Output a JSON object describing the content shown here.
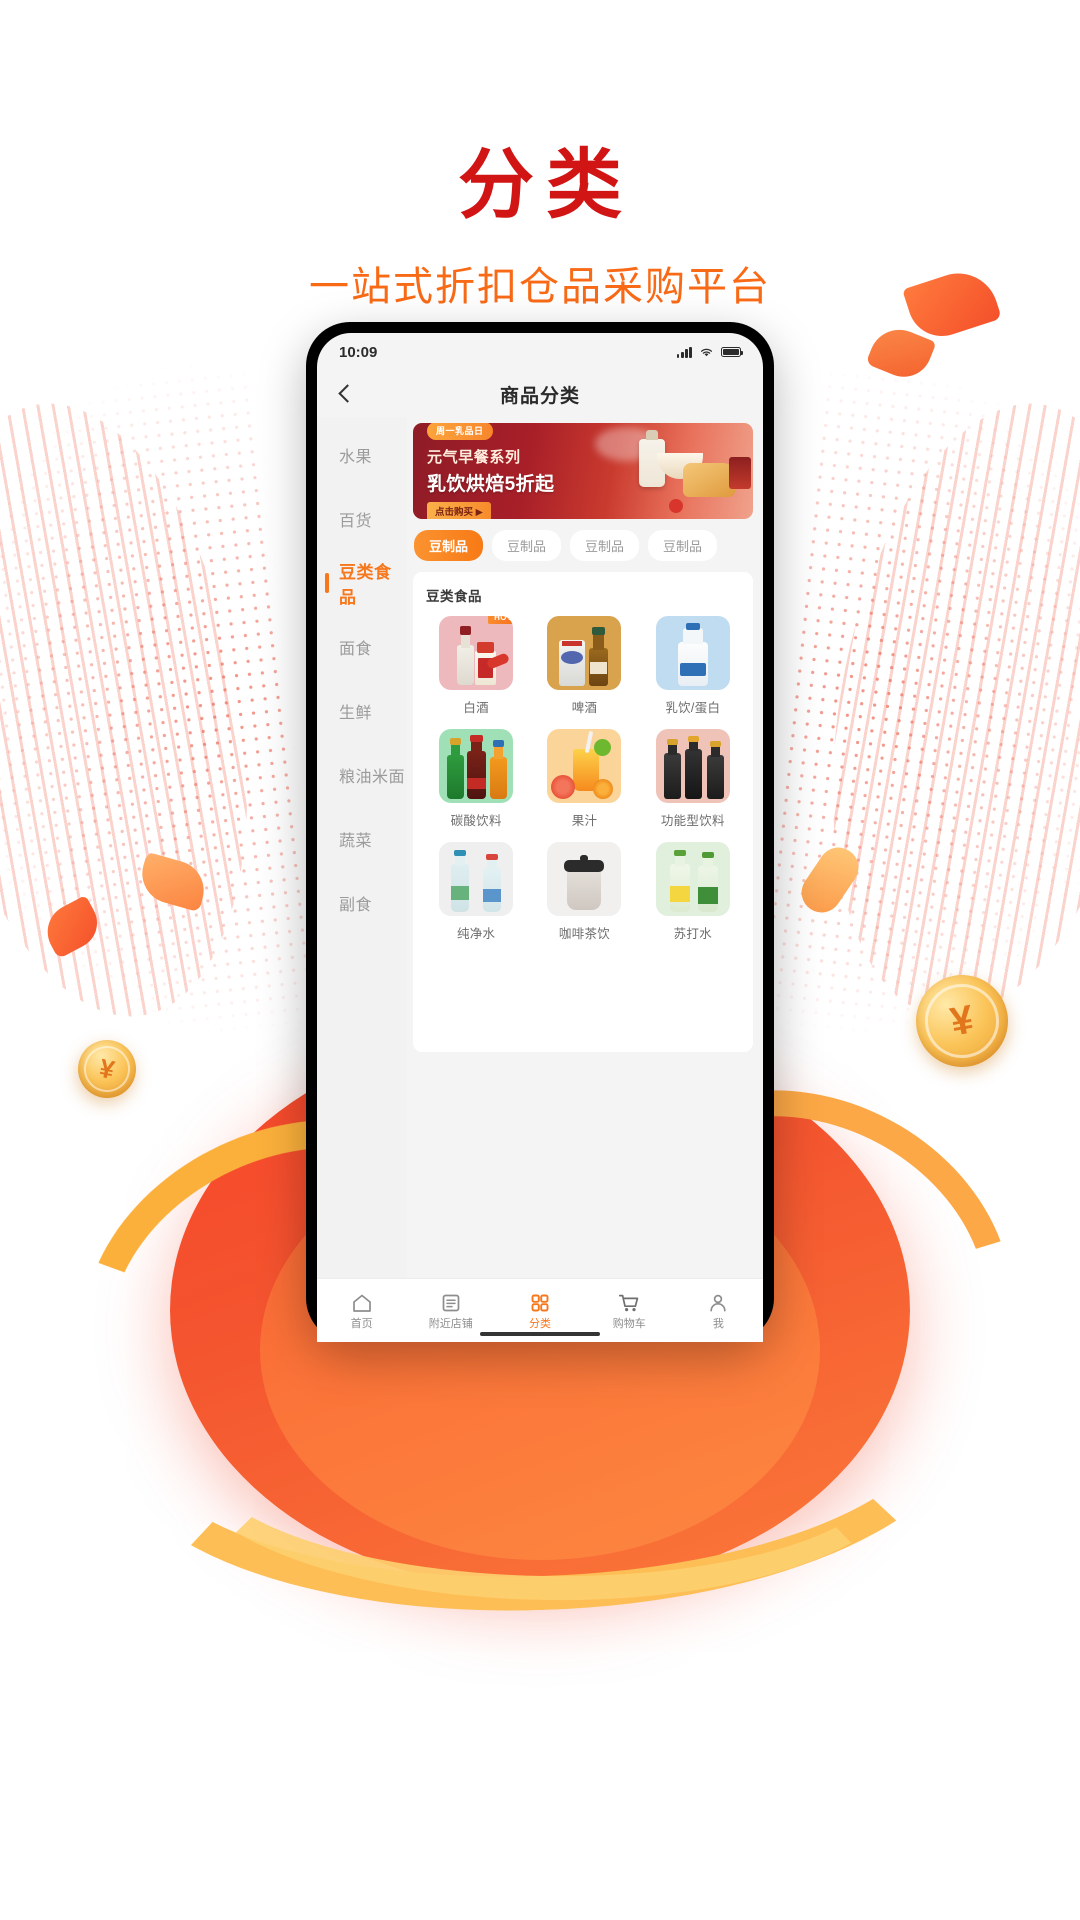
{
  "hero": {
    "title": "分类",
    "subtitle": "一站式折扣仓品采购平台",
    "title_color": "#d11414",
    "subtitle_color": "#f96a16"
  },
  "phone": {
    "statusbar": {
      "time": "10:09",
      "signal_icon": "cellular-signal-icon",
      "wifi_icon": "wifi-icon",
      "battery_icon": "battery-icon"
    },
    "navbar": {
      "back_icon": "back-chevron-icon",
      "title": "商品分类"
    },
    "sidebar": {
      "items": [
        {
          "label": "水果",
          "active": false
        },
        {
          "label": "百货",
          "active": false
        },
        {
          "label": "豆类食品",
          "active": true
        },
        {
          "label": "面食",
          "active": false
        },
        {
          "label": "生鲜",
          "active": false
        },
        {
          "label": "粮油米面",
          "active": false
        },
        {
          "label": "蔬菜",
          "active": false
        },
        {
          "label": "副食",
          "active": false
        }
      ],
      "active_color": "#f7771c"
    },
    "banner": {
      "badge": "周一乳品日",
      "line1": "元气早餐系列",
      "line2": "乳饮烘焙5折起",
      "button": "点击购买 ▶"
    },
    "tabs": [
      {
        "label": "豆制品",
        "active": true
      },
      {
        "label": "豆制品",
        "active": false
      },
      {
        "label": "豆制品",
        "active": false
      },
      {
        "label": "豆制品",
        "active": false
      }
    ],
    "panel": {
      "title": "豆类食品",
      "items": [
        {
          "label": "白酒",
          "badge": "HOT"
        },
        {
          "label": "啤酒",
          "badge": ""
        },
        {
          "label": "乳饮/蛋白",
          "badge": ""
        },
        {
          "label": "碳酸饮料",
          "badge": ""
        },
        {
          "label": "果汁",
          "badge": ""
        },
        {
          "label": "功能型饮料",
          "badge": ""
        },
        {
          "label": "纯净水",
          "badge": ""
        },
        {
          "label": "咖啡茶饮",
          "badge": ""
        },
        {
          "label": "苏打水",
          "badge": ""
        }
      ]
    },
    "tabbar": {
      "items": [
        {
          "label": "首页",
          "icon": "home-icon",
          "active": false
        },
        {
          "label": "附近店铺",
          "icon": "store-icon",
          "active": false
        },
        {
          "label": "分类",
          "icon": "grid-icon",
          "active": true
        },
        {
          "label": "购物车",
          "icon": "cart-icon",
          "active": false
        },
        {
          "label": "我",
          "icon": "user-icon",
          "active": false
        }
      ],
      "active_color": "#f7771c"
    }
  }
}
